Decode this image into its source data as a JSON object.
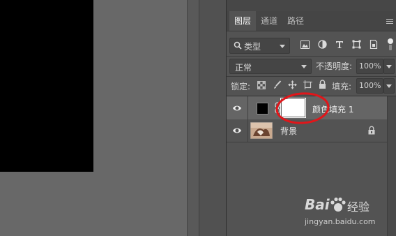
{
  "tabs": [
    "图层",
    "通道",
    "路径"
  ],
  "filter": {
    "kind_label": "类型"
  },
  "blend": {
    "mode": "正常",
    "opacity_label": "不透明度:",
    "opacity_value": "100%"
  },
  "lock": {
    "label": "锁定:",
    "fill_label": "填充:",
    "fill_value": "100%"
  },
  "layers": [
    {
      "name": "颜色填充 1",
      "type": "color-fill",
      "selected": true,
      "locked": false
    },
    {
      "name": "背景",
      "type": "background",
      "selected": false,
      "locked": true
    }
  ],
  "watermark": {
    "brand": "Bai",
    "brand2": "经验",
    "url": "jingyan.baidu.com"
  },
  "colors": {
    "panel_bg": "#535353",
    "selected_row": "#656565",
    "annotation": "#e0161a"
  }
}
